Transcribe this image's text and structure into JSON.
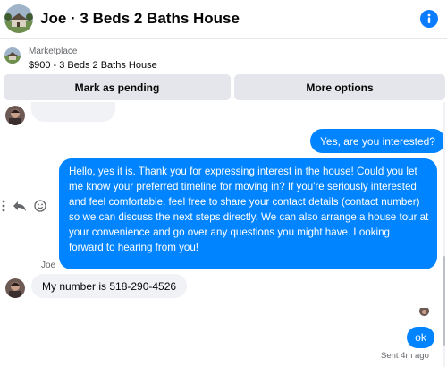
{
  "header": {
    "title": "Joe · 3 Beds 2 Baths House",
    "info_icon": "info-icon"
  },
  "marketplace": {
    "label": "Marketplace",
    "item": "$900 - 3 Beds 2 Baths House"
  },
  "actions": {
    "mark_pending": "Mark as pending",
    "more_options": "More options"
  },
  "messages": {
    "cutoff_partial": "...",
    "sent_interest": "Yes, are you interested?",
    "sent_long_lines": [
      "Hello, yes it is. Thank you for expressing interest in the house! Could you let",
      "me know your preferred timeline for moving in? If you're seriously interested",
      "and feel comfortable, feel free to share your contact details (contact number)",
      "so we can discuss the next steps directly. We can also arrange a house tour at",
      "your convenience and go over any questions you might have. Looking",
      "forward to hearing from you!"
    ],
    "received_sender": "Joe",
    "received_number": "My number is 518-290-4526",
    "sent_ok": "ok",
    "status": "Sent 4m ago"
  },
  "colors": {
    "accent_blue": "#0084ff",
    "gray_bubble": "#f0f2f5",
    "button_gray": "#e4e6eb",
    "secondary_text": "#65676b"
  }
}
